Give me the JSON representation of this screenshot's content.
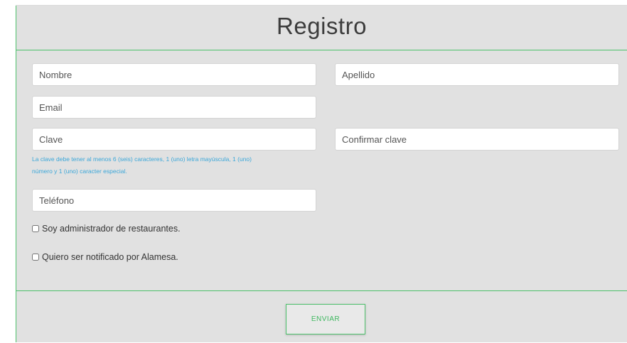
{
  "form": {
    "title": "Registro",
    "fields": {
      "nombre_placeholder": "Nombre",
      "apellido_placeholder": "Apellido",
      "email_placeholder": "Email",
      "clave_placeholder": "Clave",
      "confirmar_placeholder": "Confirmar clave",
      "telefono_placeholder": "Teléfono"
    },
    "password_hint_line1": "La clave debe tener al menos 6 (seis) caracteres, 1 (uno) letra mayúscula, 1 (uno)",
    "password_hint_line2": "número y 1 (uno) caracter especial.",
    "checkbox_admin_label": "Soy administrador de restaurantes.",
    "checkbox_notify_label": "Quiero ser notificado por Alamesa.",
    "submit_label": "ENVIAR"
  },
  "colors": {
    "accent": "#4cc06a",
    "panel_background": "#e1e1e1",
    "hint_text": "#3ba7d9"
  }
}
